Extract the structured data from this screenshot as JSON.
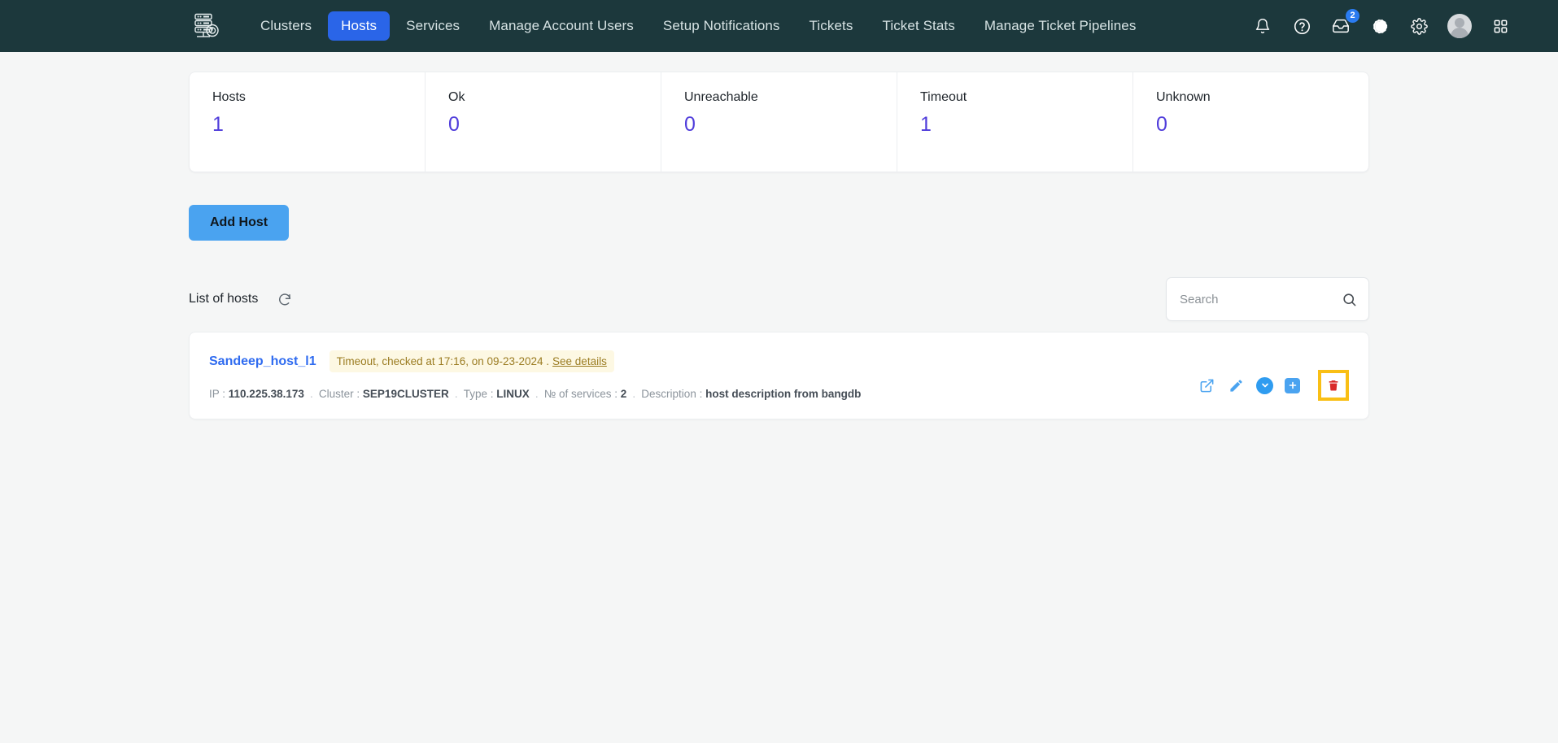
{
  "navbar": {
    "logo_name": "server-rack-logo",
    "links": [
      {
        "label": "Clusters",
        "active": false
      },
      {
        "label": "Hosts",
        "active": true
      },
      {
        "label": "Services",
        "active": false
      },
      {
        "label": "Manage Account Users",
        "active": false
      },
      {
        "label": "Setup Notifications",
        "active": false
      },
      {
        "label": "Tickets",
        "active": false
      },
      {
        "label": "Ticket Stats",
        "active": false
      },
      {
        "label": "Manage Ticket Pipelines",
        "active": false
      }
    ],
    "icons": [
      {
        "name": "bell-icon"
      },
      {
        "name": "help-circle-icon"
      },
      {
        "name": "inbox-download-icon",
        "badge": "2"
      },
      {
        "name": "dark-mode-icon"
      },
      {
        "name": "gear-icon"
      },
      {
        "name": "avatar"
      },
      {
        "name": "apps-grid-icon"
      }
    ],
    "inbox_badge": "2",
    "active_color": "#2a65e8",
    "background_color": "#1c383c"
  },
  "stats": [
    {
      "label": "Hosts",
      "value": "1"
    },
    {
      "label": "Ok",
      "value": "0"
    },
    {
      "label": "Unreachable",
      "value": "0"
    },
    {
      "label": "Timeout",
      "value": "1"
    },
    {
      "label": "Unknown",
      "value": "0"
    }
  ],
  "stats_value_color": "#4f3cdb",
  "toolbar": {
    "add_host_label": "Add Host",
    "add_host_color": "#4aa3f0"
  },
  "list": {
    "title": "List of hosts",
    "refresh_icon": "refresh-icon"
  },
  "search": {
    "placeholder": "Search",
    "value": "",
    "icon": "search-icon"
  },
  "host": {
    "name": "Sandeep_host_l1",
    "status_text": "Timeout, checked at 17:16, on 09-23-2024 .",
    "status_link": "See details",
    "status_badge_bg": "#fdf8e3",
    "status_badge_color": "#9b7c22",
    "meta": [
      {
        "label": "IP :",
        "value": "110.225.38.173"
      },
      {
        "label": "Cluster :",
        "value": "SEP19CLUSTER"
      },
      {
        "label": "Type :",
        "value": "LINUX"
      },
      {
        "label": "№ of services :",
        "value": "2"
      },
      {
        "label": "Description :",
        "value": "host description from bangdb"
      }
    ],
    "separator": ".",
    "actions": [
      {
        "name": "open-external-button"
      },
      {
        "name": "edit-button"
      },
      {
        "name": "expand-button"
      },
      {
        "name": "add-service-button"
      },
      {
        "name": "delete-button"
      }
    ],
    "delete_highlight_color": "#f9bf15",
    "delete_icon_color": "#d92b2b"
  }
}
